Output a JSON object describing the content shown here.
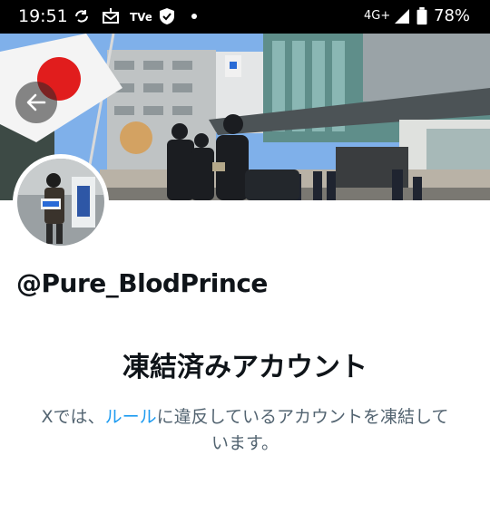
{
  "status_bar": {
    "time": "19:51",
    "network": "4G+",
    "battery": "78%"
  },
  "profile": {
    "handle": "@Pure_BlodPrince"
  },
  "suspended": {
    "title": "凍結済みアカウント",
    "message_prefix": "Xでは、",
    "rules_link": "ルール",
    "message_suffix": "に違反しているアカウントを凍結しています。"
  },
  "colors": {
    "link": "#1d9bf0",
    "text_primary": "#0f1419",
    "text_secondary": "#536471"
  }
}
